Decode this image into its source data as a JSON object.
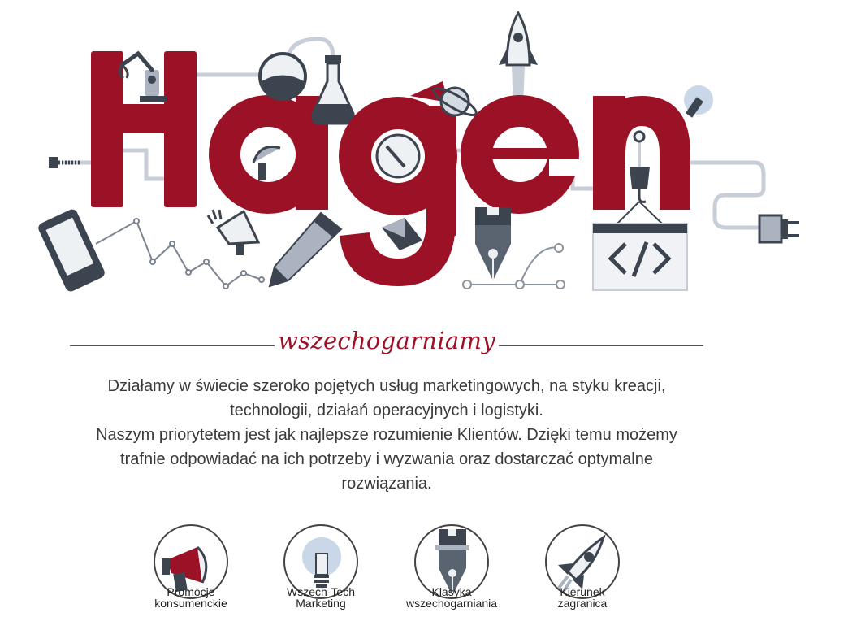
{
  "brand": {
    "logo_text": "Hagen",
    "accent": "#9b1126",
    "dark": "#3c4450",
    "steel": "#aab3bf"
  },
  "tagline": "wszechogarniamy",
  "intro": {
    "paragraph1": "Działamy w świecie szeroko pojętych usług marketingowych, na styku kreacji, technologii, działań operacyjnych i logistyki.",
    "paragraph2": "Naszym priorytetem jest jak najlepsze rozumienie Klientów. Dzięki temu możemy trafnie odpowiadać na ich potrzeby i wyzwania oraz dostarczać optymalne rozwiązania."
  },
  "services": [
    {
      "line1": "Promocje",
      "line2": "konsumenckie",
      "icon": "megaphone-icon"
    },
    {
      "line1": "Wszech-Tech",
      "line2": "Marketing",
      "icon": "lightbulb-icon"
    },
    {
      "line1": "Klasyka",
      "line2": "wszechogarniania",
      "icon": "fountain-pen-icon"
    },
    {
      "line1": "Kierunek",
      "line2": "zagranica",
      "icon": "rocket-icon"
    }
  ]
}
